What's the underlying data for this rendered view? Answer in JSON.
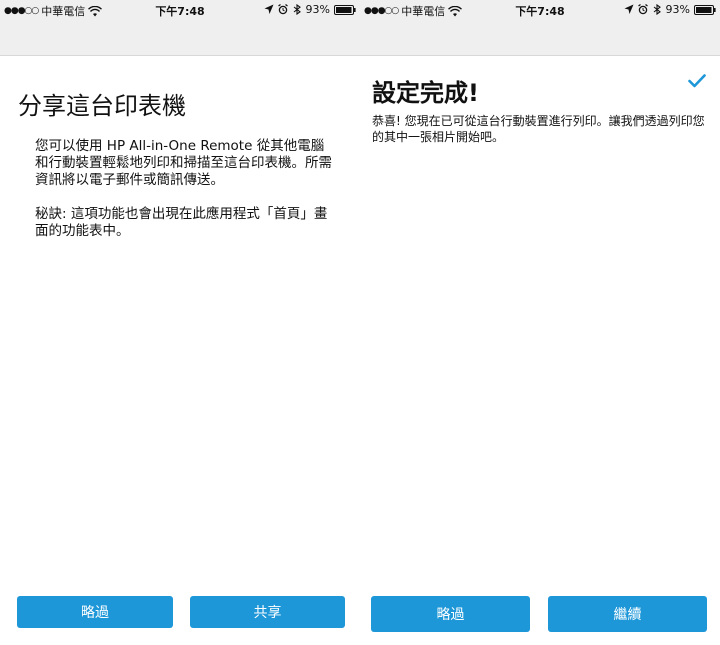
{
  "status_bar": {
    "signal_dots": "●●●○○",
    "carrier": "中華電信",
    "time": "下午7:48",
    "battery": "93%",
    "icons": [
      "signal-dots",
      "wifi-icon",
      "location-arrow-icon",
      "alarm-icon",
      "bluetooth-icon",
      "battery-icon"
    ]
  },
  "left_screen": {
    "title": "分享這台印表機",
    "paragraph1": "您可以使用 HP All-in-One Remote 從其他電腦和行動裝置輕鬆地列印和掃描至這台印表機。所需資訊將以電子郵件或簡訊傳送。",
    "paragraph2": "秘訣: 這項功能也會出現在此應用程式「首頁」畫面的功能表中。",
    "skip_label": "略過",
    "share_label": "共享"
  },
  "right_screen": {
    "title": "設定完成!",
    "message": "恭喜! 您現在已可從這台行動裝置進行列印。讓我們透過列印您的其中一張相片開始吧。",
    "skip_label": "略過",
    "continue_label": "繼續",
    "check_icon": "checkmark-icon"
  },
  "colors": {
    "accent": "#1d97d8",
    "bar_bg": "#efefef"
  }
}
